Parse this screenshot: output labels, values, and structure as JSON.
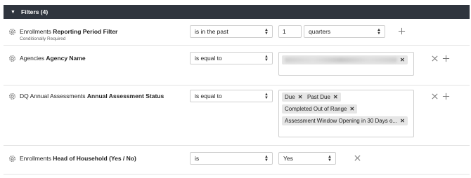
{
  "panel": {
    "title": "Filters (4)",
    "caret_icon": "caret-down-icon"
  },
  "filters": [
    {
      "prefix": "Enrollments",
      "name": "Reporting Period Filter",
      "note": "Conditionally Required",
      "operator": "is in the past",
      "number": "1",
      "unit": "quarters"
    },
    {
      "prefix": "Agencies",
      "name": "Agency Name",
      "operator": "is equal to",
      "values": [
        "[redacted]"
      ]
    },
    {
      "prefix": "DQ Annual Assessments",
      "name": "Annual Assessment Status",
      "operator": "is equal to",
      "values": [
        "Due",
        "Past Due",
        "Completed Out of Range",
        "Assessment Window Opening in 30 Days o..."
      ]
    },
    {
      "prefix": "Enrollments",
      "name": "Head of Household (Yes / No)",
      "operator": "is",
      "value": "Yes"
    }
  ],
  "icons": {
    "gear": "gear-icon",
    "add": "plus-icon",
    "remove": "close-icon",
    "select_arrow": "updown-arrow-icon"
  }
}
